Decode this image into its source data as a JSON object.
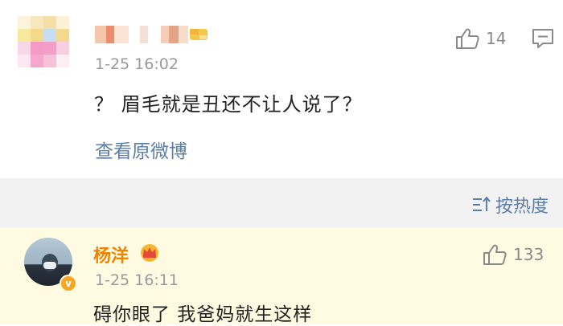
{
  "top_comment": {
    "time": "1-25 16:02",
    "text": "？ 眉毛就是丑还不让人说了？",
    "view_original_label": "查看原微博",
    "likes": "14"
  },
  "sort_bar": {
    "label": "按热度"
  },
  "reply": {
    "username": "杨洋",
    "time": "1-25 16:11",
    "text": "碍你眼了 我爸妈就生这样",
    "likes": "133",
    "verified_mark": "v"
  },
  "colors": {
    "link_blue": "#5a7ea7",
    "username_orange": "#f08300",
    "reply_highlight_bg": "#fffbe2",
    "divider_bg": "#f2f2f2"
  }
}
